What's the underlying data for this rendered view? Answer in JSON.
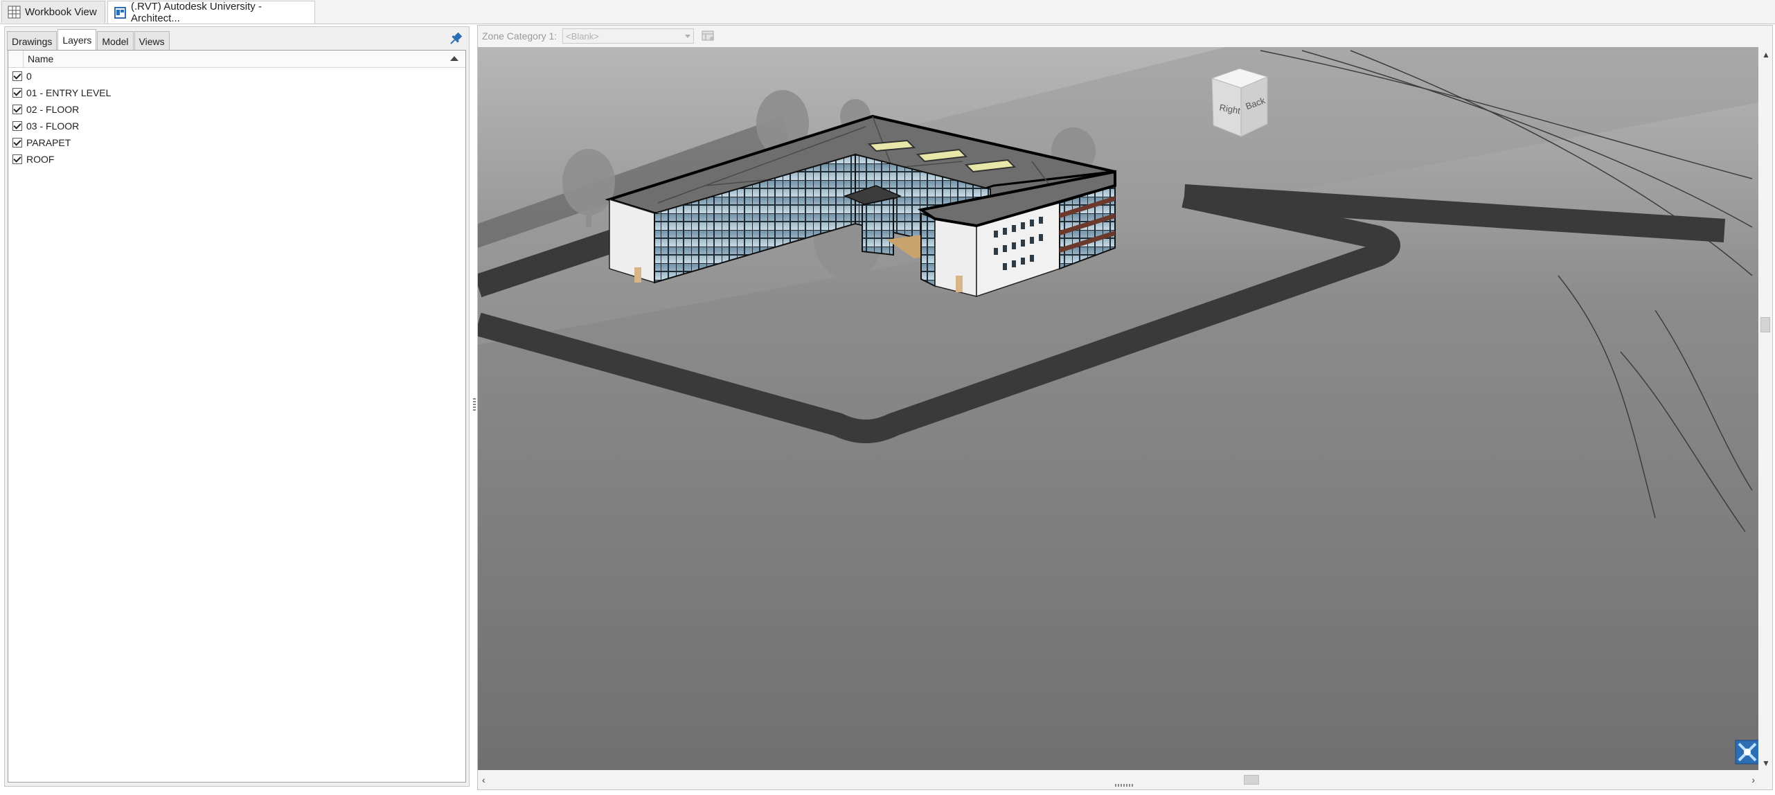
{
  "doc_tabs": [
    {
      "label": "Workbook View",
      "icon": "grid-icon",
      "active": false
    },
    {
      "label": "(.RVT) Autodesk University - Architect...",
      "icon": "rvt-file-icon",
      "active": true
    }
  ],
  "left_panel": {
    "tabs": [
      {
        "label": "Drawings",
        "active": false
      },
      {
        "label": "Layers",
        "active": true
      },
      {
        "label": "Model",
        "active": false
      },
      {
        "label": "Views",
        "active": false
      }
    ],
    "column_header": "Name",
    "layers": [
      {
        "name": "0",
        "checked": true
      },
      {
        "name": "01 - ENTRY LEVEL",
        "checked": true
      },
      {
        "name": "02 - FLOOR",
        "checked": true
      },
      {
        "name": "03 - FLOOR",
        "checked": true
      },
      {
        "name": "PARAPET",
        "checked": true
      },
      {
        "name": "ROOF",
        "checked": true
      }
    ]
  },
  "zone_bar": {
    "label": "Zone Category 1:",
    "selected": "<Blank>"
  },
  "view_cube": {
    "face_right": "Right",
    "face_back": "Back"
  },
  "colors": {
    "ground": "#8a8a8a",
    "road": "#3a3a3a",
    "roof": "#6e6e6e",
    "glass": "#9fb8c8",
    "accent": "#2d6db3"
  }
}
